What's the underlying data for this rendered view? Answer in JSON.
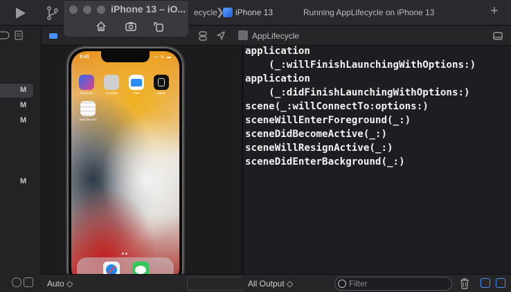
{
  "toolbar": {
    "scheme_fragment": "ecycle",
    "device_name": "iPhone 13",
    "run_status": "Running AppLifecycle on iPhone 13",
    "plus_label": "+"
  },
  "simulator": {
    "title": "iPhone 13 – iO..."
  },
  "editor": {
    "file_name": "AppLifecycle"
  },
  "navigator": {
    "badges": [
      "M",
      "M",
      "M",
      "M"
    ]
  },
  "phone": {
    "time": "9:41",
    "status_right": "▪▪ ≋ ▬",
    "apps": [
      {
        "label": "Shortcuts",
        "color": "#7d3cf0"
      },
      {
        "label": "Contacts",
        "color": "#c9c9c9"
      },
      {
        "label": "Files",
        "color": "#2b8ef5"
      },
      {
        "label": "Watch",
        "color": "#111111"
      },
      {
        "label": "AppLifecycle",
        "color": "#f4f4f4"
      }
    ],
    "dock": [
      {
        "name": "Safari",
        "color": "#f0f4f8"
      },
      {
        "name": "Messages",
        "color": "#34c759"
      }
    ]
  },
  "console": {
    "lines": [
      "application",
      "    (_:willFinishLaunchingWithOptions:)",
      "application",
      "    (_:didFinishLaunchingWithOptions:)",
      "scene(_:willConnectTo:options:)",
      "sceneWillEnterForeground(_:)",
      "sceneDidBecomeActive(_:)",
      "sceneWillResignActive(_:)",
      "sceneDidEnterBackground(_:)"
    ]
  },
  "bottombar": {
    "variables_scope": "Auto ◇",
    "output_scope": "All Output ◇",
    "filter_placeholder": "Filter"
  },
  "colors": {
    "accent": "#4a90ff",
    "console_text": "#f2f2f2",
    "background": "#1e1e22"
  }
}
